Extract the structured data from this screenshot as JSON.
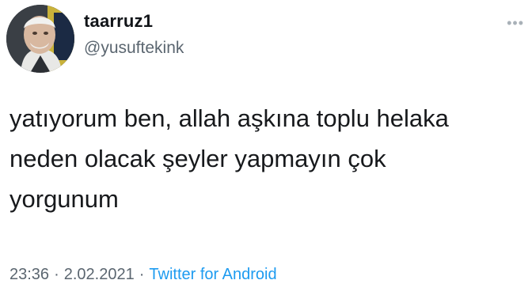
{
  "tweet": {
    "display_name": "taarruz1",
    "handle": "@yusuftekink",
    "more_icon": "more-options-icon",
    "text_lines": [
      "yatıyorum ben, allah aşkına toplu helaka",
      "neden olacak şeyler yapmayın çok",
      "yorgunum"
    ],
    "time": "23:36",
    "date": "2.02.2021",
    "separator": "·",
    "source": "Twitter for Android"
  },
  "colors": {
    "text": "#17191c",
    "secondary": "#5b6670",
    "link": "#1d9bf0"
  }
}
